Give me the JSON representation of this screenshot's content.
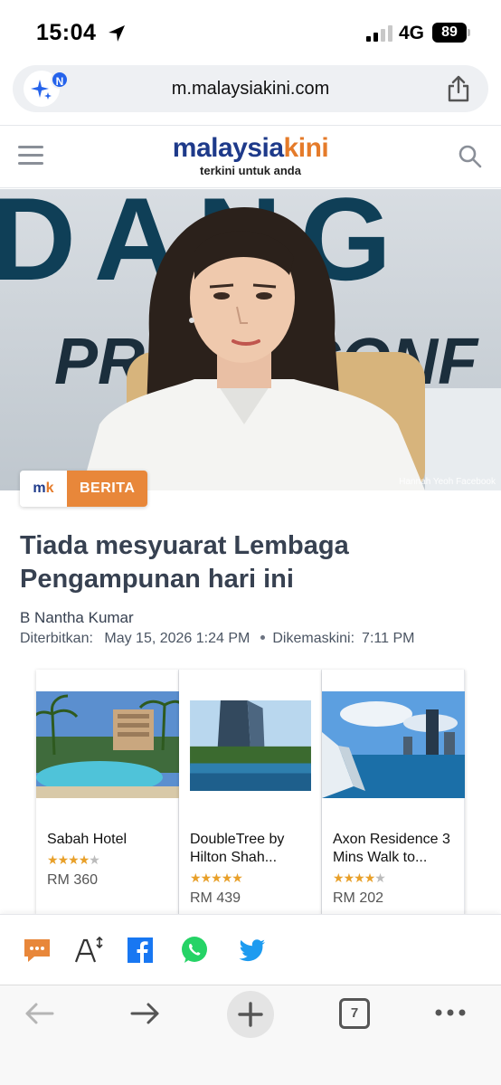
{
  "status": {
    "time": "15:04",
    "network": "4G",
    "battery": "89"
  },
  "browser": {
    "url": "m.malaysiakini.com",
    "ai_badge": "N",
    "tab_count": "7"
  },
  "site": {
    "logo_part1": "malaysia",
    "logo_part2": "kini",
    "tagline": "terkini untuk anda"
  },
  "hero": {
    "credit": "Hannah Yeoh Facebook",
    "backdrop_text": "DANG",
    "backdrop_text2": "PRESS CONF"
  },
  "article": {
    "category_logo_a": "m",
    "category_logo_b": "k",
    "category": "BERITA",
    "headline": "Tiada mesyuarat Lembaga Pengampunan hari ini",
    "author": "B Nantha Kumar",
    "published_label": "Diterbitkan:",
    "published": "May 15, 2026 1:24 PM",
    "updated_label": "Dikemaskini:",
    "updated": "7:11 PM"
  },
  "hotels": [
    {
      "name": "Sabah Hotel",
      "rating": 4,
      "price": "RM 360"
    },
    {
      "name": "DoubleTree by Hilton Shah...",
      "rating": 5,
      "price": "RM 439"
    },
    {
      "name": "Axon Residence 3 Mins Walk to...",
      "rating": 4,
      "price": "RM 202"
    }
  ],
  "share_icons": [
    "comment-icon",
    "font-size-icon",
    "facebook-icon",
    "whatsapp-icon",
    "twitter-icon"
  ],
  "colors": {
    "brand_blue": "#1e3a8a",
    "brand_orange": "#e57b2a",
    "category": "#e8873a"
  }
}
